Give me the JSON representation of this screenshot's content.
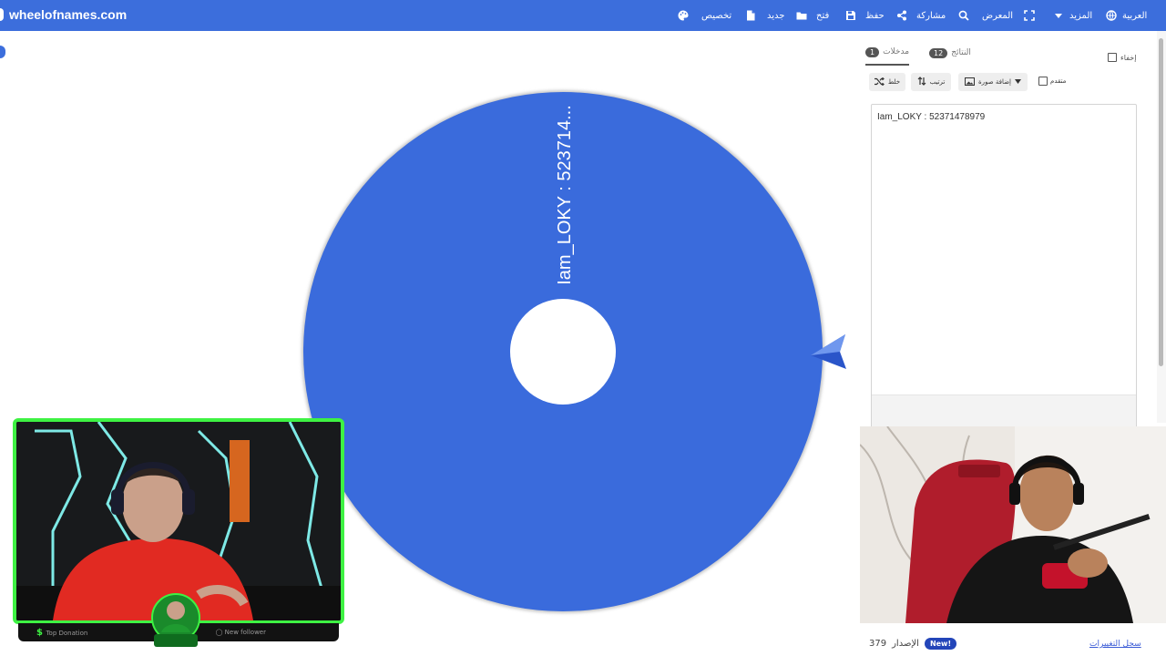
{
  "header": {
    "site": "wheelofnames.com",
    "menu": [
      {
        "label": "العربية",
        "icon": "globe-icon"
      },
      {
        "label": "المزيد",
        "icon": "caret-down-icon"
      },
      {
        "label": "",
        "icon": "fullscreen-icon"
      },
      {
        "label": "المعرض",
        "icon": "search-icon"
      },
      {
        "label": "مشاركة",
        "icon": "share-icon"
      },
      {
        "label": "حفظ",
        "icon": "save-icon"
      },
      {
        "label": "فتح",
        "icon": "folder-icon"
      },
      {
        "label": "جديد",
        "icon": "new-file-icon"
      },
      {
        "label": "تخصيص",
        "icon": "palette-icon"
      }
    ]
  },
  "wheel": {
    "segment_label": "Iam_LOKY : 523714...",
    "color": "#3a6bdc"
  },
  "panel": {
    "tabs": {
      "entries_label": "مدخلات",
      "entries_count": "1",
      "results_label": "النتائج",
      "results_count": "12"
    },
    "hide_label": "إخفاء",
    "toolbar": {
      "shuffle_label": "خلط",
      "sort_label": "ترتيب",
      "add_image_label": "إضافة صورة",
      "advanced_label": "متقدم"
    },
    "entries": [
      "Iam_LOKY : 52371478979"
    ]
  },
  "footer": {
    "version_label": "الإصدار",
    "version_number": "379",
    "new_badge": "New!",
    "changelog_link": "سجل التغييرات"
  },
  "webcam_left": {
    "top_donation_label": "Top Donation",
    "new_follower_label": "New follower"
  },
  "colors": {
    "header_bg": "#3c6edc",
    "wheel": "#3a6bdc",
    "cam_border": "#3ef243"
  }
}
